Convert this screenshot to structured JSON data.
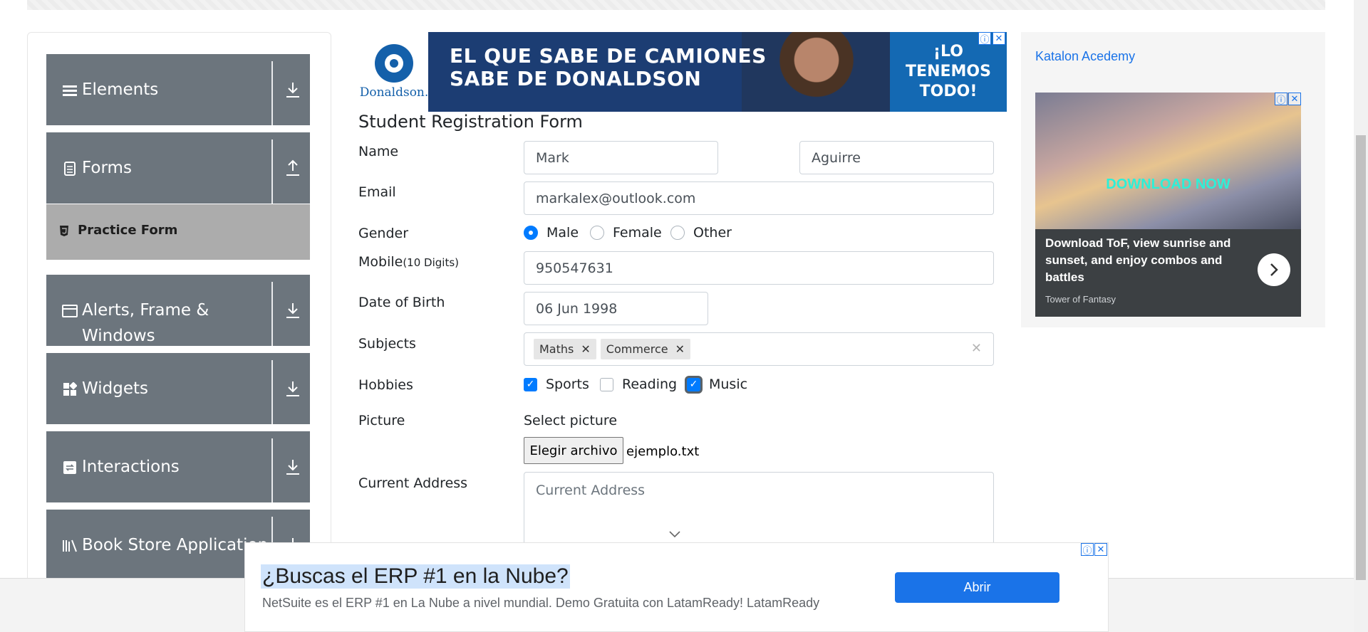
{
  "sidebar": {
    "groups": [
      {
        "label": "Elements",
        "icon": "menu-icon",
        "arrow": "download-icon"
      },
      {
        "label": "Forms",
        "icon": "document-icon",
        "arrow": "upload-icon"
      },
      {
        "label": "Alerts, Frame & Windows",
        "icon": "window-icon",
        "arrow": "download-icon"
      },
      {
        "label": "Widgets",
        "icon": "widgets-icon",
        "arrow": "download-icon"
      },
      {
        "label": "Interactions",
        "icon": "interactions-icon",
        "arrow": "download-icon"
      },
      {
        "label": "Book Store Application",
        "icon": "books-icon",
        "arrow": "download-icon"
      }
    ],
    "sub_item": {
      "label": "Practice Form",
      "icon": "html5-icon"
    }
  },
  "ad_top": {
    "brand": "Donaldson.",
    "headline_1": "EL QUE SABE DE CAMIONES",
    "headline_2": "SABE DE DONALDSON",
    "right_1": "¡LO",
    "right_2": "TENEMOS",
    "right_3": "TODO!"
  },
  "ad_side": {
    "link": "Katalon Acedemy",
    "download": "DOWNLOAD NOW",
    "description": "Download ToF, view sunrise and sunset, and enjoy combos and battles",
    "source": "Tower of Fantasy"
  },
  "form": {
    "title": "Student Registration Form",
    "labels": {
      "name": "Name",
      "email": "Email",
      "gender": "Gender",
      "mobile": "Mobile",
      "mobile_hint": "(10 Digits)",
      "dob": "Date of Birth",
      "subjects": "Subjects",
      "hobbies": "Hobbies",
      "picture": "Picture",
      "address": "Current Address"
    },
    "first_name": "Mark",
    "last_name": "Aguirre",
    "email": "markalex@outlook.com",
    "gender_options": [
      "Male",
      "Female",
      "Other"
    ],
    "gender_selected": "Male",
    "mobile": "950547631",
    "dob": "06 Jun 1998",
    "subjects": [
      "Maths",
      "Commerce"
    ],
    "hobbies": [
      {
        "label": "Sports",
        "checked": true
      },
      {
        "label": "Reading",
        "checked": false
      },
      {
        "label": "Music",
        "checked": true
      }
    ],
    "picture_label": "Select picture",
    "file_button": "Elegir archivo",
    "file_name": "ejemplo.txt",
    "address_placeholder": "Current Address"
  },
  "ad_bottom": {
    "headline": "¿Buscas el ERP #1 en la Nube?",
    "description": "NetSuite es el ERP #1 en La Nube a nivel mundial. Demo Gratuita con LatamReady! LatamReady",
    "button": "Abrir"
  },
  "colors": {
    "sidebar_bg": "#6c757d",
    "sub_item_bg": "#acacac",
    "accent": "#007bff",
    "ad_button": "#1a73e8"
  }
}
